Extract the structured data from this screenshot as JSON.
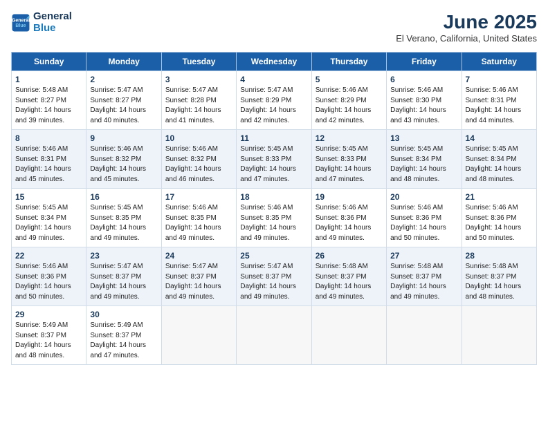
{
  "header": {
    "logo_line1": "General",
    "logo_line2": "Blue",
    "month": "June 2025",
    "location": "El Verano, California, United States"
  },
  "days_of_week": [
    "Sunday",
    "Monday",
    "Tuesday",
    "Wednesday",
    "Thursday",
    "Friday",
    "Saturday"
  ],
  "weeks": [
    [
      {
        "day": "1",
        "sunrise": "5:48 AM",
        "sunset": "8:27 PM",
        "daylight": "14 hours and 39 minutes."
      },
      {
        "day": "2",
        "sunrise": "5:47 AM",
        "sunset": "8:27 PM",
        "daylight": "14 hours and 40 minutes."
      },
      {
        "day": "3",
        "sunrise": "5:47 AM",
        "sunset": "8:28 PM",
        "daylight": "14 hours and 41 minutes."
      },
      {
        "day": "4",
        "sunrise": "5:47 AM",
        "sunset": "8:29 PM",
        "daylight": "14 hours and 42 minutes."
      },
      {
        "day": "5",
        "sunrise": "5:46 AM",
        "sunset": "8:29 PM",
        "daylight": "14 hours and 42 minutes."
      },
      {
        "day": "6",
        "sunrise": "5:46 AM",
        "sunset": "8:30 PM",
        "daylight": "14 hours and 43 minutes."
      },
      {
        "day": "7",
        "sunrise": "5:46 AM",
        "sunset": "8:31 PM",
        "daylight": "14 hours and 44 minutes."
      }
    ],
    [
      {
        "day": "8",
        "sunrise": "5:46 AM",
        "sunset": "8:31 PM",
        "daylight": "14 hours and 45 minutes."
      },
      {
        "day": "9",
        "sunrise": "5:46 AM",
        "sunset": "8:32 PM",
        "daylight": "14 hours and 45 minutes."
      },
      {
        "day": "10",
        "sunrise": "5:46 AM",
        "sunset": "8:32 PM",
        "daylight": "14 hours and 46 minutes."
      },
      {
        "day": "11",
        "sunrise": "5:45 AM",
        "sunset": "8:33 PM",
        "daylight": "14 hours and 47 minutes."
      },
      {
        "day": "12",
        "sunrise": "5:45 AM",
        "sunset": "8:33 PM",
        "daylight": "14 hours and 47 minutes."
      },
      {
        "day": "13",
        "sunrise": "5:45 AM",
        "sunset": "8:34 PM",
        "daylight": "14 hours and 48 minutes."
      },
      {
        "day": "14",
        "sunrise": "5:45 AM",
        "sunset": "8:34 PM",
        "daylight": "14 hours and 48 minutes."
      }
    ],
    [
      {
        "day": "15",
        "sunrise": "5:45 AM",
        "sunset": "8:34 PM",
        "daylight": "14 hours and 49 minutes."
      },
      {
        "day": "16",
        "sunrise": "5:45 AM",
        "sunset": "8:35 PM",
        "daylight": "14 hours and 49 minutes."
      },
      {
        "day": "17",
        "sunrise": "5:46 AM",
        "sunset": "8:35 PM",
        "daylight": "14 hours and 49 minutes."
      },
      {
        "day": "18",
        "sunrise": "5:46 AM",
        "sunset": "8:35 PM",
        "daylight": "14 hours and 49 minutes."
      },
      {
        "day": "19",
        "sunrise": "5:46 AM",
        "sunset": "8:36 PM",
        "daylight": "14 hours and 49 minutes."
      },
      {
        "day": "20",
        "sunrise": "5:46 AM",
        "sunset": "8:36 PM",
        "daylight": "14 hours and 50 minutes."
      },
      {
        "day": "21",
        "sunrise": "5:46 AM",
        "sunset": "8:36 PM",
        "daylight": "14 hours and 50 minutes."
      }
    ],
    [
      {
        "day": "22",
        "sunrise": "5:46 AM",
        "sunset": "8:36 PM",
        "daylight": "14 hours and 50 minutes."
      },
      {
        "day": "23",
        "sunrise": "5:47 AM",
        "sunset": "8:37 PM",
        "daylight": "14 hours and 49 minutes."
      },
      {
        "day": "24",
        "sunrise": "5:47 AM",
        "sunset": "8:37 PM",
        "daylight": "14 hours and 49 minutes."
      },
      {
        "day": "25",
        "sunrise": "5:47 AM",
        "sunset": "8:37 PM",
        "daylight": "14 hours and 49 minutes."
      },
      {
        "day": "26",
        "sunrise": "5:48 AM",
        "sunset": "8:37 PM",
        "daylight": "14 hours and 49 minutes."
      },
      {
        "day": "27",
        "sunrise": "5:48 AM",
        "sunset": "8:37 PM",
        "daylight": "14 hours and 49 minutes."
      },
      {
        "day": "28",
        "sunrise": "5:48 AM",
        "sunset": "8:37 PM",
        "daylight": "14 hours and 48 minutes."
      }
    ],
    [
      {
        "day": "29",
        "sunrise": "5:49 AM",
        "sunset": "8:37 PM",
        "daylight": "14 hours and 48 minutes."
      },
      {
        "day": "30",
        "sunrise": "5:49 AM",
        "sunset": "8:37 PM",
        "daylight": "14 hours and 47 minutes."
      },
      null,
      null,
      null,
      null,
      null
    ]
  ]
}
